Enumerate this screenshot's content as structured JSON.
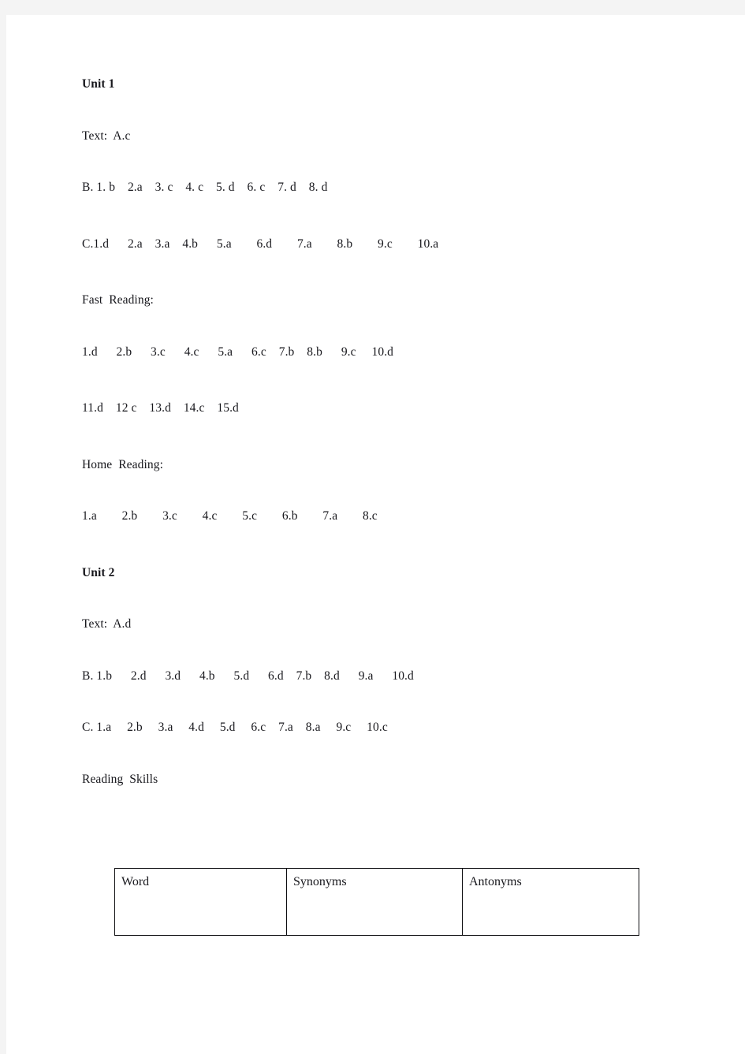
{
  "page": {
    "background_color": "#f4f4f4",
    "sheet_color": "#ffffff",
    "text_color": "#17171c",
    "rule_color": "#0d0d10"
  },
  "content": {
    "unit1_heading": "Unit 1",
    "unit1_text_line": "Text:  A.c",
    "unit1_b_line": "B. 1. b    2.a    3. c    4. c    5. d    6. c    7. d    8. d",
    "unit1_c_line": "C.1.d      2.a    3.a    4.b      5.a        6.d        7.a        8.b        9.c        10.a",
    "fast_reading_label": "Fast  Reading:",
    "fast_reading_line1": "1.d      2.b      3.c      4.c      5.a      6.c    7.b    8.b      9.c     10.d",
    "fast_reading_line2": "11.d    12 c    13.d    14.c    15.d",
    "home_reading_label": "Home  Reading:",
    "home_reading_line1": "1.a        2.b        3.c        4.c        5.c        6.b        7.a        8.c",
    "unit2_heading": "Unit 2",
    "unit2_text_line": "Text:  A.d",
    "unit2_b_line": "B. 1.b      2.d      3.d      4.b      5.d      6.d    7.b    8.d      9.a      10.d",
    "unit2_c_line": "C. 1.a     2.b     3.a     4.d     5.d     6.c    7.a    8.a     9.c     10.c",
    "reading_skills_label": "Reading  Skills"
  },
  "skills_table": {
    "headers": [
      "Word",
      "Synonyms",
      "Antonyms"
    ],
    "rows": []
  }
}
